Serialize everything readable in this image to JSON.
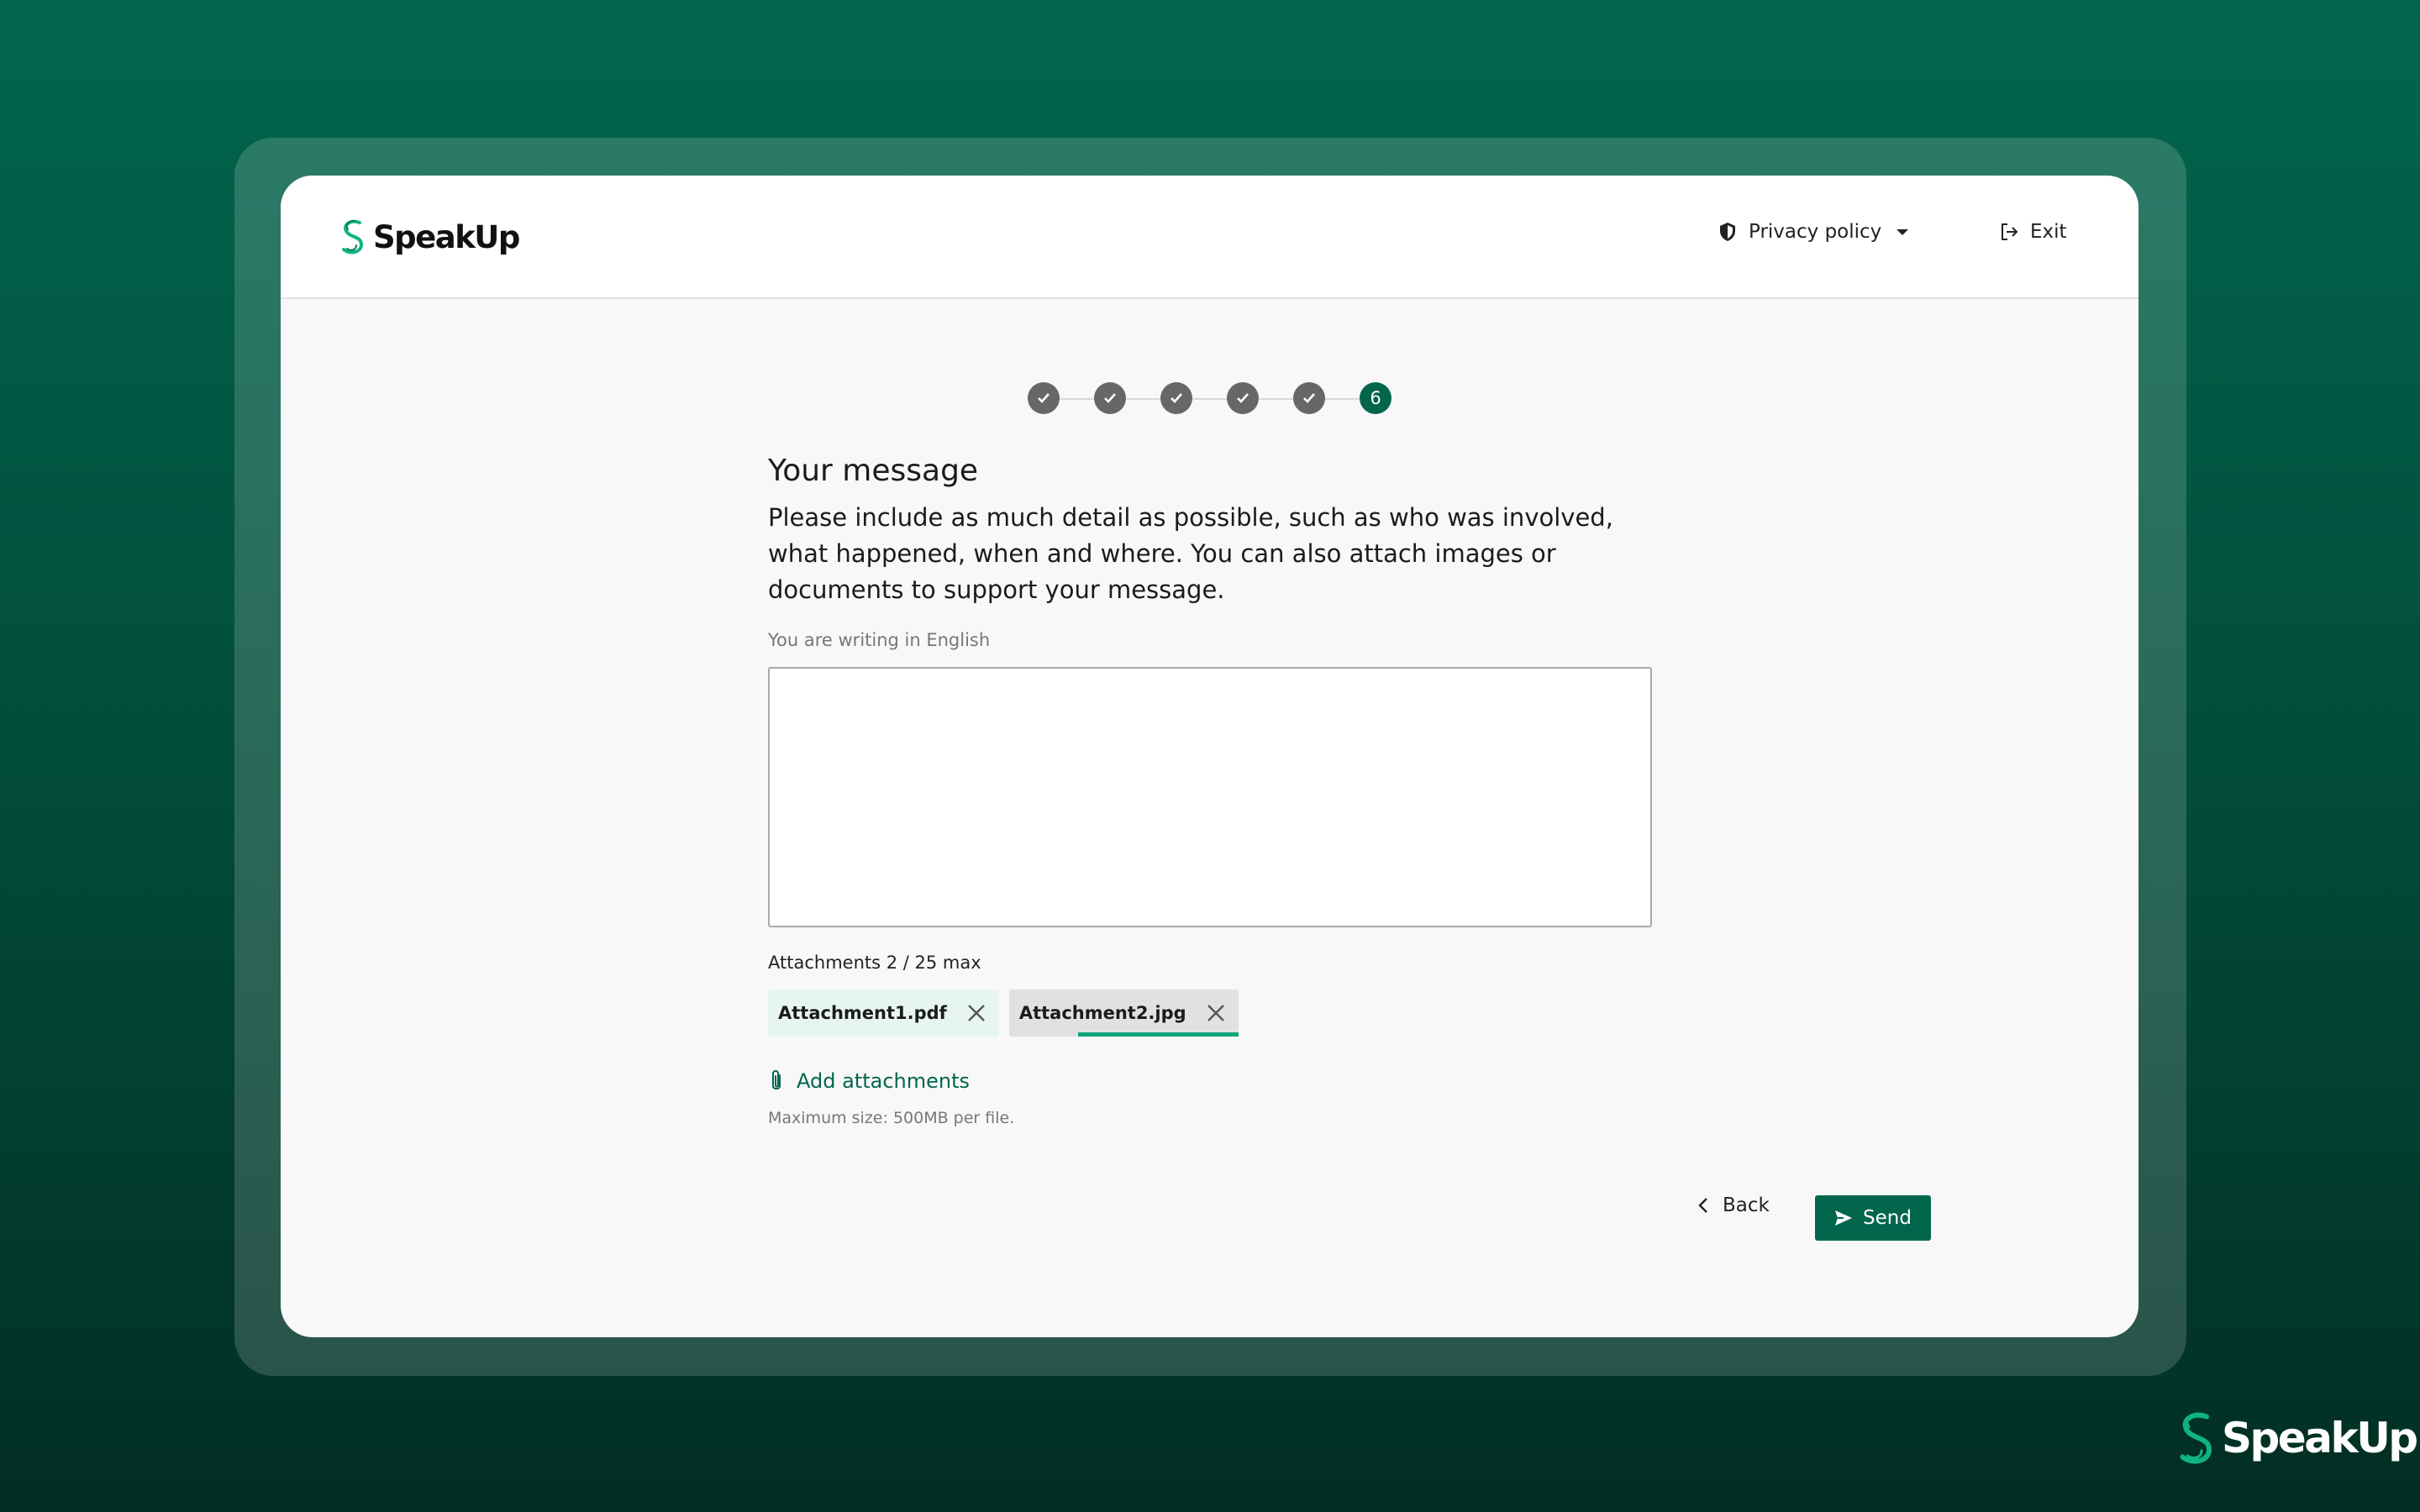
{
  "header": {
    "brand": "SpeakUp",
    "privacy_label": "Privacy policy",
    "exit_label": "Exit"
  },
  "stepper": {
    "steps": [
      {
        "status": "completed",
        "icon": "check-icon"
      },
      {
        "status": "completed",
        "icon": "check-icon"
      },
      {
        "status": "completed",
        "icon": "check-icon"
      },
      {
        "status": "completed",
        "icon": "check-icon"
      },
      {
        "status": "completed",
        "icon": "check-icon"
      },
      {
        "status": "active",
        "label": "6"
      }
    ]
  },
  "form": {
    "title": "Your message",
    "intro": "Please include as much detail as possible, such as who was involved, what happened, when and where. You can also attach images or documents to support your message.",
    "language_note": "You are writing in English",
    "message_value": "",
    "attachments_label": "Attachments 2 / 25 max",
    "attachments": [
      {
        "name": "Attachment1.pdf",
        "status": "uploaded"
      },
      {
        "name": "Attachment2.jpg",
        "status": "uploading",
        "progress": 0.7
      }
    ],
    "add_attachments_label": "Add attachments",
    "max_size_note": "Maximum size: 500MB per file."
  },
  "actions": {
    "back_label": "Back",
    "send_label": "Send"
  },
  "footer": {
    "brand": "SpeakUp"
  },
  "colors": {
    "brand_green": "#02664d",
    "accent_green": "#11a57d",
    "step_completed": "#676767"
  },
  "icons": [
    "speakup-logo-icon",
    "shield-icon",
    "chevron-down-icon",
    "exit-icon",
    "check-icon",
    "close-icon",
    "paperclip-icon",
    "chevron-left-icon",
    "send-icon"
  ]
}
